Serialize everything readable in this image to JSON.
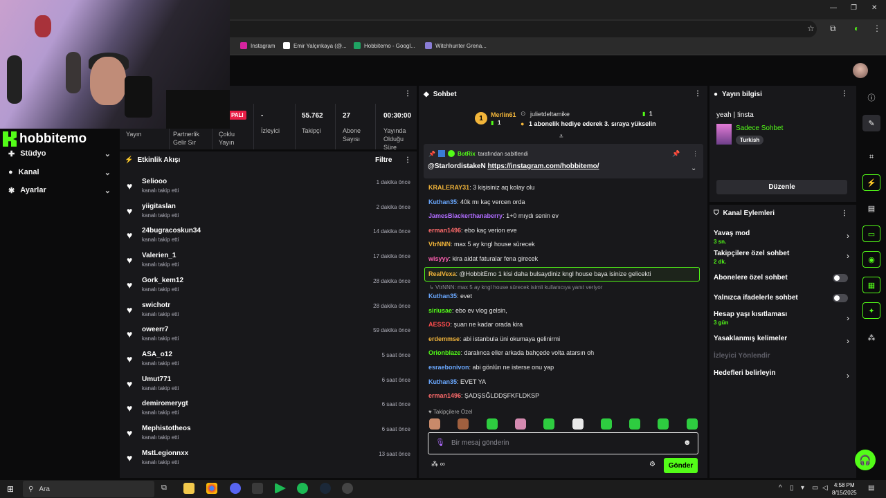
{
  "browser": {
    "bookmarks": [
      {
        "label": "Instagram",
        "color": "#d6249f"
      },
      {
        "label": "Emir Yalçınkaya (@...",
        "color": "#ffffff"
      },
      {
        "label": "Hobbitemo - Googl...",
        "color": "#1fa463"
      },
      {
        "label": "Witchhunter Grena...",
        "color": "#8a7dd6"
      }
    ]
  },
  "brand": {
    "name": "hobbitemo",
    "accent": "#53fc18"
  },
  "sidebar": {
    "items": [
      {
        "label": "Stüdyo"
      },
      {
        "label": "Kanal"
      },
      {
        "label": "Ayarlar"
      }
    ]
  },
  "stats": {
    "badge": "PALI",
    "items": [
      {
        "label": "Yayın",
        "value": ""
      },
      {
        "label": "Partnerlik Gelir Sır",
        "value": ""
      },
      {
        "label": "Çoklu Yayın",
        "value": ""
      },
      {
        "label": "İzleyici",
        "value": "-"
      },
      {
        "label": "Takipçi",
        "value": "55.762"
      },
      {
        "label": "Abone Sayısı",
        "value": "27"
      },
      {
        "label": "Yayında Olduğu Süre",
        "value": "00:30:00"
      }
    ]
  },
  "feed": {
    "title": "Etkinlik Akışı",
    "filter": "Filtre",
    "items": [
      {
        "name": "Seliooo",
        "sub": "kanalı takip etti",
        "time": "1 dakika önce"
      },
      {
        "name": "yiigitaslan",
        "sub": "kanalı takip etti",
        "time": "2 dakika önce"
      },
      {
        "name": "24bugracoskun34",
        "sub": "kanalı takip etti",
        "time": "14 dakika önce"
      },
      {
        "name": "Valerien_1",
        "sub": "kanalı takip etti",
        "time": "17 dakika önce"
      },
      {
        "name": "Gork_kem12",
        "sub": "kanalı takip etti",
        "time": "28 dakika önce"
      },
      {
        "name": "swichotr",
        "sub": "kanalı takip etti",
        "time": "28 dakika önce"
      },
      {
        "name": "oweerr7",
        "sub": "kanalı takip etti",
        "time": "59 dakika önce"
      },
      {
        "name": "ASA_o12",
        "sub": "kanalı takip etti",
        "time": "5 saat önce"
      },
      {
        "name": "Umut771",
        "sub": "kanalı takip etti",
        "time": "6 saat önce"
      },
      {
        "name": "demiromerygt",
        "sub": "kanalı takip etti",
        "time": "6 saat önce"
      },
      {
        "name": "Mephistotheos",
        "sub": "kanalı takip etti",
        "time": "6 saat önce"
      },
      {
        "name": "MstLegionnxx",
        "sub": "kanalı takip etti",
        "time": "13 saat önce"
      }
    ]
  },
  "chat": {
    "title": "Sohbet",
    "leader": {
      "rank": "1",
      "name": "Merlin61",
      "count": "1"
    },
    "gifter": {
      "name": "julietdeltamike",
      "count": "1",
      "message": "1 abonelik hediye ederek 3. sıraya yükselin"
    },
    "pinned": {
      "by": "BotRix",
      "by_suffix": "tarafından sabitlendi",
      "mention": "@StarlordistakeN",
      "link": "https://instagram.com/hobbitemo/"
    },
    "messages": [
      {
        "user": "KRALERAY31",
        "color": "#f2b53a",
        "text": ": 3 kişisiniz aq kolay olu"
      },
      {
        "user": "Kuthan35",
        "color": "#6aa8ff",
        "text": ": 40k mı kaç vercen orda"
      },
      {
        "user": "JamesBlackerthanaberry",
        "color": "#b06cff",
        "text": ": 1+0 mıydı senin ev"
      },
      {
        "user": "erman1496",
        "color": "#ff6b6b",
        "text": ": ebo kaç verion eve"
      },
      {
        "user": "VtrNNN",
        "color": "#f2b53a",
        "text": ": max 5 ay kngl house sürecek"
      },
      {
        "user": "wisyyy",
        "color": "#ff5fb0",
        "text": ": kira aidat faturalar fena girecek"
      }
    ],
    "highlight": {
      "user": "RealVexa",
      "color": "#f2b53a",
      "text": ": @HobbitEmo 1 kisi daha bulsaydiniz kngl house baya isinize gelicekti"
    },
    "reply_note": "VtrNNN: max 5 ay kngl house sürecek isimli kullanıcıya yanıt veriyor",
    "messages2": [
      {
        "user": "Kuthan35",
        "color": "#6aa8ff",
        "text": ": evet"
      },
      {
        "user": "siriusae",
        "color": "#53fc18",
        "text": ": ebo ev vlog gelsin,"
      },
      {
        "user": "AESSO",
        "color": "#ff4d4d",
        "text": ": şuan ne kadar orada kira"
      },
      {
        "user": "erdemmse",
        "color": "#f2b53a",
        "text": ": abi istanbula üni okumaya gelinirmi"
      },
      {
        "user": "Orionblaze",
        "color": "#53fc18",
        "text": ": daralınca eller arkada bahçede volta atarsın oh"
      },
      {
        "user": "esraebonivon",
        "color": "#6aa8ff",
        "text": ": abi gönlün ne isterse onu yap"
      },
      {
        "user": "Kuthan35",
        "color": "#6aa8ff",
        "text": ": EVET YA"
      },
      {
        "user": "erman1496",
        "color": "#ff6b6b",
        "text": ": ŞADŞSĞLDDŞFKFLDKSP"
      }
    ],
    "followers_only": "Takipçilere Özel",
    "input_placeholder": "Bir mesaj gönderin",
    "send": "Gönder"
  },
  "info": {
    "title": "Yayın bilgisi",
    "stream_title": "yeah | !insta",
    "category": "Sadece Sohbet",
    "tag": "Turkish",
    "edit": "Düzenle"
  },
  "actions": {
    "title": "Kanal Eylemleri",
    "items": [
      {
        "label": "Yavaş mod",
        "value": "3 sn."
      },
      {
        "label": "Takipçilere özel sohbet",
        "value": "2 dk."
      },
      {
        "label": "Abonelere özel sohbet",
        "value": ""
      },
      {
        "label": "Yalnızca ifadelerle sohbet",
        "value": ""
      },
      {
        "label": "Hesap yaşı kısıtlaması",
        "value": "3 gün"
      },
      {
        "label": "Yasaklanmış kelimeler",
        "value": ""
      },
      {
        "label": "İzleyici Yönlendir",
        "value": ""
      },
      {
        "label": "Hedefleri belirleyin",
        "value": ""
      }
    ]
  },
  "taskbar": {
    "search": "Ara",
    "time": "4:58 PM",
    "date": "8/15/2025"
  }
}
